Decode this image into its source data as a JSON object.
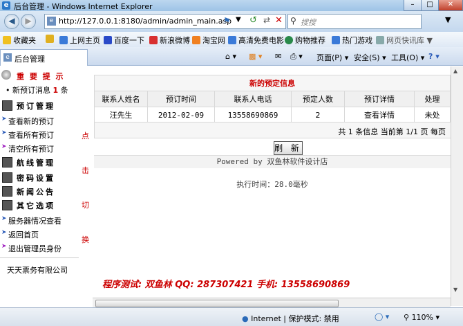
{
  "window": {
    "title": "后台管理 - Windows Internet Explorer"
  },
  "address": {
    "url": "http://127.0.0.1:8180/admin/admin_main.asp"
  },
  "search": {
    "placeholder": "搜搜"
  },
  "favorites": {
    "label": "收藏夹",
    "items": [
      "上网主页",
      "百度一下",
      "新浪微博",
      "淘宝网",
      "高清免费电影",
      "购物推荐",
      "热门游戏",
      "网页快讯库"
    ]
  },
  "tab": {
    "label": "后台管理"
  },
  "commands": {
    "page": "页面(P)",
    "safety": "安全(S)",
    "tools": "工具(O)",
    "help": "?"
  },
  "sidebar": {
    "notice_title": "重 要 提 示",
    "new_msg_prefix": "新预订消息",
    "new_msg_count": "1",
    "new_msg_suffix": "条",
    "sections": [
      {
        "title": "预订管理"
      },
      {
        "title": "航线管理"
      },
      {
        "title": "密码设置"
      },
      {
        "title": "新闻公告"
      },
      {
        "title": "其它选项"
      }
    ],
    "booking_items": [
      "查看新的预订",
      "查看所有预订",
      "清空所有预订"
    ],
    "other_items": [
      "服务器情况查看",
      "返回首页",
      "退出管理员身份"
    ],
    "company": "天天票务有限公司"
  },
  "toggle_labels": [
    "点",
    "击",
    "切",
    "换"
  ],
  "main": {
    "table_title": "新的预定信息",
    "headers": [
      "联系人姓名",
      "预订时间",
      "联系人电话",
      "预定人数",
      "预订详情",
      "处理"
    ],
    "rows": [
      [
        "汪先生",
        "2012-02-09",
        "13558690869",
        "2",
        "查看详情",
        "未处"
      ]
    ],
    "pager": "共 1 条信息 当前第 1/1 页 每页",
    "refresh_label": "刷 新",
    "powered": "Powered by 双鱼林软件设计店",
    "exec_time": "执行时间：28.0毫秒",
    "tester": "程序测试: 双鱼林  QQ: 287307421  手机: 13558690869"
  },
  "status": {
    "zone": "Internet | 保护模式: 禁用",
    "zoom": "110%"
  }
}
